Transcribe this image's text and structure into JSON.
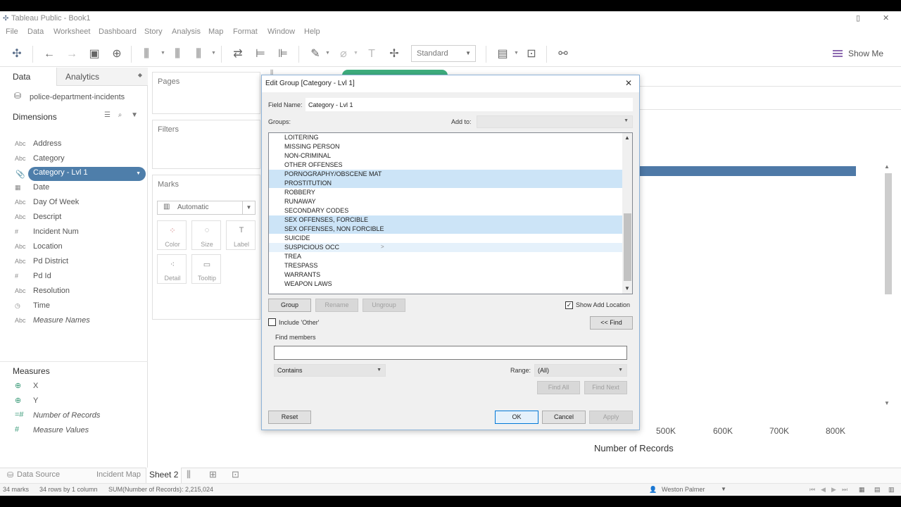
{
  "window": {
    "title": "Tableau Public - Book1",
    "minimize": "▯",
    "close": "✕"
  },
  "menu": [
    "File",
    "Data",
    "Worksheet",
    "Dashboard",
    "Story",
    "Analysis",
    "Map",
    "Format",
    "Window",
    "Help"
  ],
  "toolbar": {
    "fit_label": "Standard",
    "show_me": "Show Me"
  },
  "data_pane": {
    "tab_data": "Data",
    "tab_analytics": "Analytics",
    "datasource": "police-department-incidents",
    "dimensions_header": "Dimensions",
    "dimensions": [
      {
        "type": "Abc",
        "name": "Address"
      },
      {
        "type": "Abc",
        "name": "Category"
      },
      {
        "type": "📎",
        "name": "Category - Lvl 1",
        "selected": true
      },
      {
        "type": "▦",
        "name": "Date"
      },
      {
        "type": "Abc",
        "name": "Day Of Week"
      },
      {
        "type": "Abc",
        "name": "Descript"
      },
      {
        "type": "#",
        "name": "Incident Num"
      },
      {
        "type": "Abc",
        "name": "Location"
      },
      {
        "type": "Abc",
        "name": "Pd District"
      },
      {
        "type": "#",
        "name": "Pd Id"
      },
      {
        "type": "Abc",
        "name": "Resolution"
      },
      {
        "type": "◷",
        "name": "Time"
      },
      {
        "type": "Abc",
        "name": "Measure Names",
        "italic": true
      }
    ],
    "measures_header": "Measures",
    "measures": [
      {
        "type": "⊕",
        "name": "X"
      },
      {
        "type": "⊕",
        "name": "Y"
      },
      {
        "type": "=#",
        "name": "Number of Records",
        "italic": true
      },
      {
        "type": "#",
        "name": "Measure Values",
        "italic": true
      }
    ]
  },
  "shelves": {
    "pages": "Pages",
    "filters": "Filters",
    "marks": "Marks",
    "marks_type": "Automatic",
    "mark_buttons": [
      {
        "icon": "⁘",
        "label": "Color"
      },
      {
        "icon": "◌",
        "label": "Size"
      },
      {
        "icon": "T",
        "label": "Label"
      },
      {
        "icon": "⁖",
        "label": "Detail"
      },
      {
        "icon": "▭",
        "label": "Tooltip"
      }
    ]
  },
  "view": {
    "axis_ticks": [
      "500K",
      "600K",
      "700K",
      "800K"
    ],
    "axis_title": "Number of Records"
  },
  "sheet_tabs": {
    "data_source": "Data Source",
    "incident_map": "Incident Map",
    "sheet2": "Sheet 2"
  },
  "status": {
    "marks": "34 marks",
    "rows": "34 rows by 1 column",
    "sum": "SUM(Number of Records): 2,215,024",
    "user": "Weston Palmer"
  },
  "dialog": {
    "title": "Edit Group [Category - Lvl 1]",
    "field_name_label": "Field Name:",
    "field_name_value": "Category - Lvl 1",
    "groups_label": "Groups:",
    "add_to_label": "Add to:",
    "items": [
      {
        "text": "LOITERING",
        "state": ""
      },
      {
        "text": "MISSING PERSON",
        "state": ""
      },
      {
        "text": "NON-CRIMINAL",
        "state": ""
      },
      {
        "text": "OTHER OFFENSES",
        "state": ""
      },
      {
        "text": "PORNOGRAPHY/OBSCENE MAT",
        "state": "sel"
      },
      {
        "text": "PROSTITUTION",
        "state": "sel"
      },
      {
        "text": "ROBBERY",
        "state": ""
      },
      {
        "text": "RUNAWAY",
        "state": ""
      },
      {
        "text": "SECONDARY CODES",
        "state": ""
      },
      {
        "text": "SEX OFFENSES, FORCIBLE",
        "state": "sel"
      },
      {
        "text": "SEX OFFENSES, NON FORCIBLE",
        "state": "sel"
      },
      {
        "text": "SUICIDE",
        "state": ""
      },
      {
        "text": "SUSPICIOUS OCC",
        "state": "hov"
      },
      {
        "text": "TREA",
        "state": ""
      },
      {
        "text": "TRESPASS",
        "state": ""
      },
      {
        "text": "WARRANTS",
        "state": ""
      },
      {
        "text": "WEAPON LAWS",
        "state": ""
      }
    ],
    "btn_group": "Group",
    "btn_rename": "Rename",
    "btn_ungroup": "Ungroup",
    "show_add_location": "Show Add Location",
    "include_other": "Include 'Other'",
    "btn_find": "<< Find",
    "find_members_label": "Find members",
    "find_value": "",
    "match_mode": "Contains",
    "range_label": "Range:",
    "range_value": "(All)",
    "btn_find_all": "Find All",
    "btn_find_next": "Find Next",
    "btn_reset": "Reset",
    "btn_ok": "OK",
    "btn_cancel": "Cancel",
    "btn_apply": "Apply"
  }
}
